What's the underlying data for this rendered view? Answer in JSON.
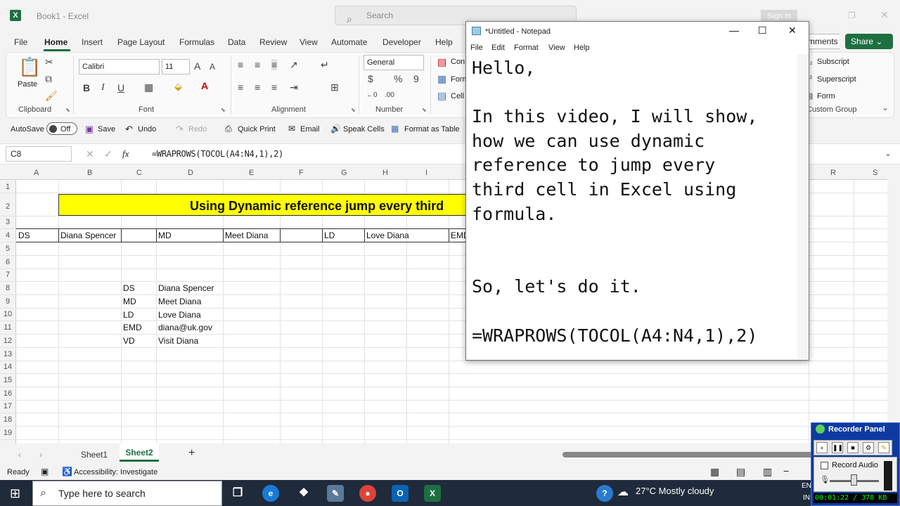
{
  "window": {
    "title": "Book1 - Excel",
    "search_placeholder": "Search",
    "signin": "Sign in"
  },
  "menu": {
    "tabs": [
      "File",
      "Home",
      "Insert",
      "Page Layout",
      "Formulas",
      "Data",
      "Review",
      "View",
      "Automate",
      "Developer",
      "Help"
    ],
    "comments": "mments",
    "share": "Share"
  },
  "ribbon": {
    "clipboard": {
      "label": "Clipboard",
      "paste": "Paste"
    },
    "font": {
      "label": "Font",
      "name": "Calibri",
      "size": "11",
      "bold": "B",
      "italic": "I",
      "underline": "U"
    },
    "alignment": {
      "label": "Alignment"
    },
    "number": {
      "label": "Number",
      "format": "General"
    },
    "styles": {
      "conditional": "Con",
      "format_table": "Form",
      "cell_styles": "Cell"
    },
    "custom": {
      "subscript": "Subscript",
      "superscript": "Superscript",
      "form": "Form",
      "label": "Custom Group"
    }
  },
  "qat": {
    "autosave": "AutoSave",
    "autosave_state": "Off",
    "save": "Save",
    "undo": "Undo",
    "redo": "Redo",
    "quick_print": "Quick Print",
    "email": "Email",
    "speak_cells": "Speak Cells",
    "format_as_table": "Format as Table"
  },
  "formula_bar": {
    "name_box": "C8",
    "fx": "fx",
    "formula": "=WRAPROWS(TOCOL(A4:N4,1),2)"
  },
  "grid": {
    "columns": [
      "A",
      "B",
      "C",
      "D",
      "E",
      "F",
      "G",
      "H",
      "I",
      "R",
      "S"
    ],
    "rows": [
      "1",
      "2",
      "3",
      "4",
      "5",
      "6",
      "7",
      "8",
      "9",
      "10",
      "11",
      "12",
      "13",
      "14",
      "15",
      "16",
      "17",
      "18",
      "19"
    ],
    "banner": "Using Dynamic reference jump every third",
    "row4": [
      "DS",
      "Diana Spencer",
      "MD",
      "Meet Diana",
      "LD",
      "Love Diana",
      "EMD"
    ],
    "result": [
      [
        "DS",
        "Diana Spencer"
      ],
      [
        "MD",
        "Meet Diana"
      ],
      [
        "LD",
        "Love Diana"
      ],
      [
        "EMD",
        "diana@uk.gov"
      ],
      [
        "VD",
        "Visit Diana"
      ]
    ]
  },
  "sheets": {
    "tabs": [
      "Sheet1",
      "Sheet2"
    ],
    "active": "Sheet2"
  },
  "status": {
    "ready": "Ready",
    "accessibility": "Accessibility: Investigate"
  },
  "notepad": {
    "title": "*Untitled - Notepad",
    "menu": [
      "File",
      "Edit",
      "Format",
      "View",
      "Help"
    ],
    "lines": [
      "Hello,",
      "",
      "In this video, I will show,",
      "how we can use dynamic",
      "reference to jump every",
      "third cell in Excel using",
      "formula.",
      "",
      "",
      "So, let's do it.",
      "",
      "=WRAPROWS(TOCOL(A4:N4,1),2)"
    ]
  },
  "taskbar": {
    "search_placeholder": "Type here to search",
    "weather": "27°C  Mostly cloudy",
    "lang": "EN",
    "lang2": "IN"
  },
  "recorder": {
    "title": "Recorder Panel",
    "record_audio": "Record Audio",
    "status": "00:01:22 / 378 KB"
  },
  "colors": {
    "excel_green": "#1d6f42",
    "banner_yellow": "#ffff00",
    "taskbar": "#1f2a3a",
    "recorder": "#0e3aa0"
  }
}
